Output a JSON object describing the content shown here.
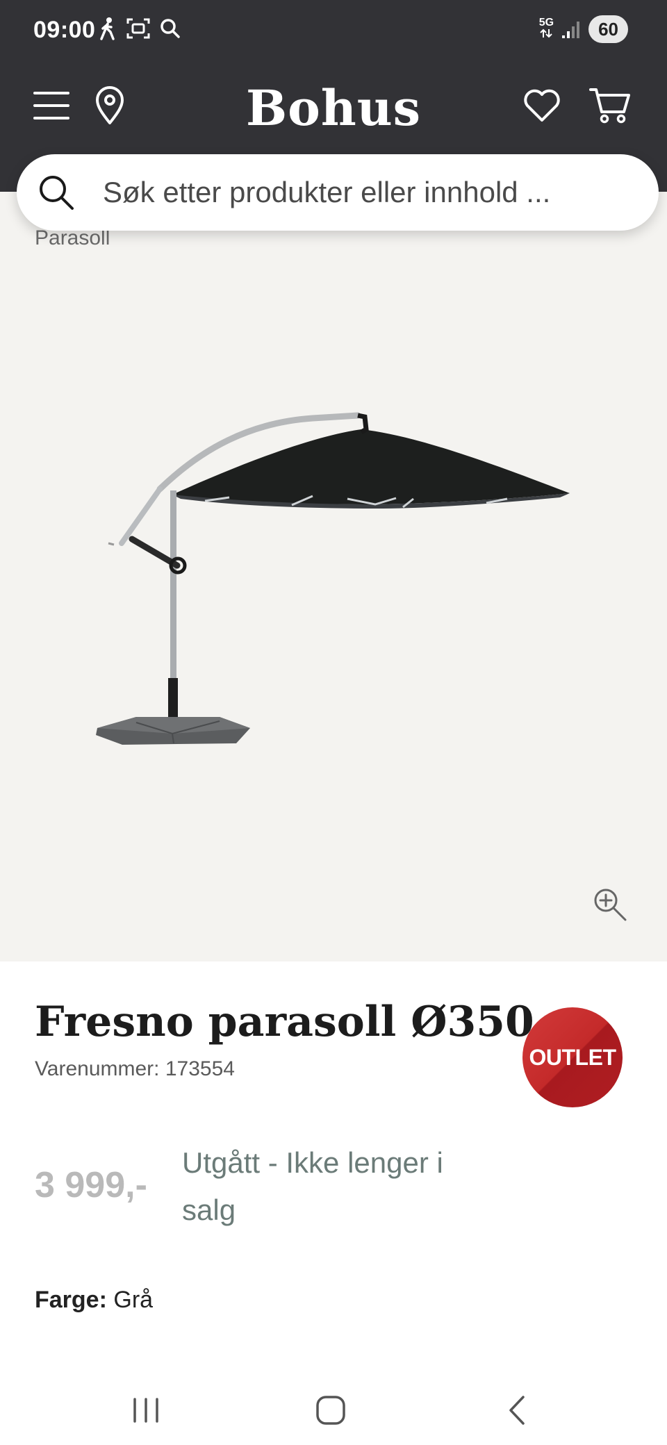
{
  "status_bar": {
    "time": "09:00",
    "network": "5G",
    "battery": "60"
  },
  "header": {
    "logo": "Bohus",
    "icons": [
      "menu-icon",
      "location-pin-icon",
      "heart-icon",
      "cart-icon"
    ]
  },
  "search": {
    "placeholder": "Søk etter produkter eller innhold ..."
  },
  "breadcrumb": "Parasoll",
  "product": {
    "title": "Fresno parasoll Ø350",
    "sku_label": "Varenummer: ",
    "sku_value": "173554",
    "badge": "OUTLET",
    "price": "3 999,-",
    "availability": "Utgått - Ikke lenger i salg",
    "color_label": "Farge:",
    "color_value": "Grå"
  },
  "colors": {
    "header_bg": "#323236",
    "image_bg": "#f4f3f0",
    "outlet_red": "#c42a2a",
    "availability_text": "#6b7b78",
    "price_text": "#b9b9b9"
  },
  "nav": {
    "icons": [
      "recent-apps-icon",
      "home-icon",
      "back-icon"
    ]
  }
}
